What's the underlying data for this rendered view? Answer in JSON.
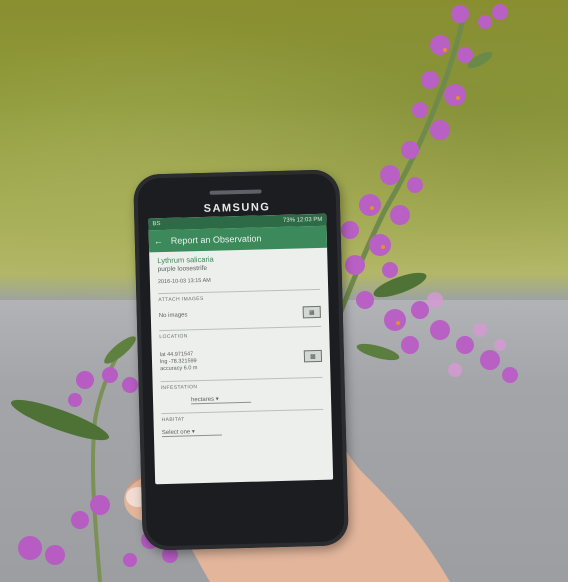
{
  "phone": {
    "brand": "SAMSUNG",
    "status_bar": {
      "left": "BS",
      "right": "73% 12:03 PM"
    }
  },
  "app": {
    "back_icon": "arrow-left-icon",
    "title": "Report an Observation",
    "species_name": "Lythrum salicaria",
    "common_name": "purple loosestrife",
    "date": "2016-10-03 13:15 AM",
    "sections": {
      "attach_images": "ATTACH IMAGES",
      "no_images": "No images",
      "location": "LOCATION",
      "lat": "lat  44.971547",
      "lng": "lng  -78.321599",
      "accuracy": "accuracy  6.0 m",
      "infestation": "INFESTATION",
      "infestation_value": "hectares",
      "habitat": "HABITAT",
      "habitat_value": "Select one"
    },
    "icons": {
      "images": "image-gallery-icon",
      "location": "satellite-map-icon"
    }
  }
}
